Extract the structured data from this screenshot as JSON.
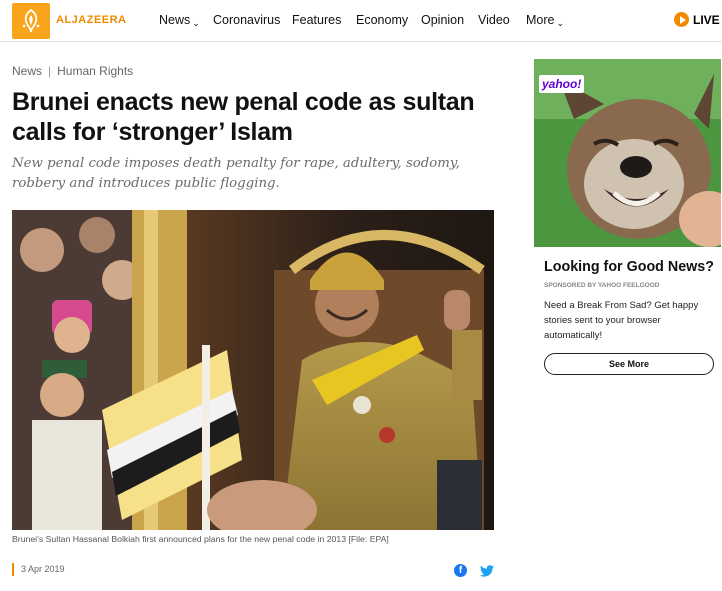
{
  "site": {
    "logo_text": "ALJAZEERA",
    "brand_color": "#f18a00"
  },
  "nav": {
    "items": [
      {
        "label": "News",
        "has_dropdown": true
      },
      {
        "label": "Coronavirus",
        "has_dropdown": false
      },
      {
        "label": "Features",
        "has_dropdown": false
      },
      {
        "label": "Economy",
        "has_dropdown": false
      },
      {
        "label": "Opinion",
        "has_dropdown": false
      },
      {
        "label": "Video",
        "has_dropdown": false
      },
      {
        "label": "More",
        "has_dropdown": true
      }
    ],
    "chevron": "⌄",
    "live_label": "LIVE"
  },
  "article": {
    "breadcrumb": [
      "News",
      "Human Rights"
    ],
    "breadcrumb_sep": "|",
    "headline": "Brunei enacts new penal code as sultan calls for ‘stronger’ Islam",
    "subheadline": "New penal code imposes death penalty for rape, adultery, sodomy, robbery and introduces public flogging.",
    "image_caption": "Brunei’s Sultan Hassanal Bolkiah first announced plans for the new penal code in 2013 [File: EPA]",
    "date": "3 Apr 2019",
    "share_icons": [
      "facebook-icon",
      "twitter-icon"
    ]
  },
  "sidebar_ad": {
    "badge": "yahoo!",
    "title": "Looking for Good News?",
    "sponsor": "SPONSORED BY YAHOO FEELGOOD",
    "body": "Need a Break From Sad? Get happy stories sent to your browser automatically!",
    "button_label": "See More"
  }
}
